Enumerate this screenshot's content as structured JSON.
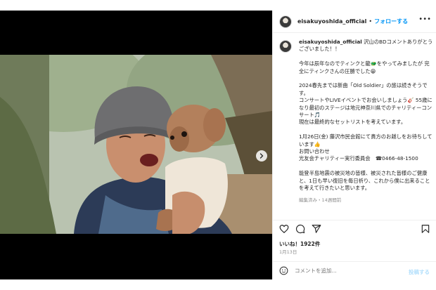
{
  "post": {
    "username": "eisakuyoshida_official",
    "follow_label": "フォローする",
    "dot": "•",
    "more_label": "•••"
  },
  "caption": {
    "username": "eisakuyoshida_official",
    "paragraphs": [
      "沢山のBDコメントありがとうございました！！",
      "今年は辰年なのでティンクと龍🐲をやってみましたが 完全にティンクさんの圧勝でした😁",
      "2024春先までは新曲「Old Soldier」の旅は続きそうです。\nコンサートやLIVEイベントでお会いしましょう🎸 55歳になり最初のステージは地元神奈川県でのチャリティーコンサート🎵\n現在は最終的なセットリストを考えています。",
      "1月26日(金) 藤沢市民会館にて貴方のお越しをお待ちしています👍\nお問い合わせ\n光友会チャリティー実行委員会　☎0466-48-1500",
      "能登半島地震の被災地の皆様、被災された皆様のご健康と、1日も早い復旧を毎日祈り、これから僕に出来ることを考えて行きたいと思います。"
    ],
    "meta": "編集済み・14週間前"
  },
  "likes": "いいね！1922件",
  "date": "1月13日",
  "comment": {
    "placeholder": "コメントを追加...",
    "post_label": "投稿する"
  },
  "icons": {
    "heart": "heart-icon",
    "comment": "comment-icon",
    "share": "share-icon",
    "save": "bookmark-icon",
    "emoji": "emoji-icon",
    "next": "chevron-right-icon"
  },
  "colors": {
    "accent": "#0095f6",
    "post_disabled": "#b2dffc",
    "muted": "#8e8e8e",
    "text": "#262626"
  }
}
